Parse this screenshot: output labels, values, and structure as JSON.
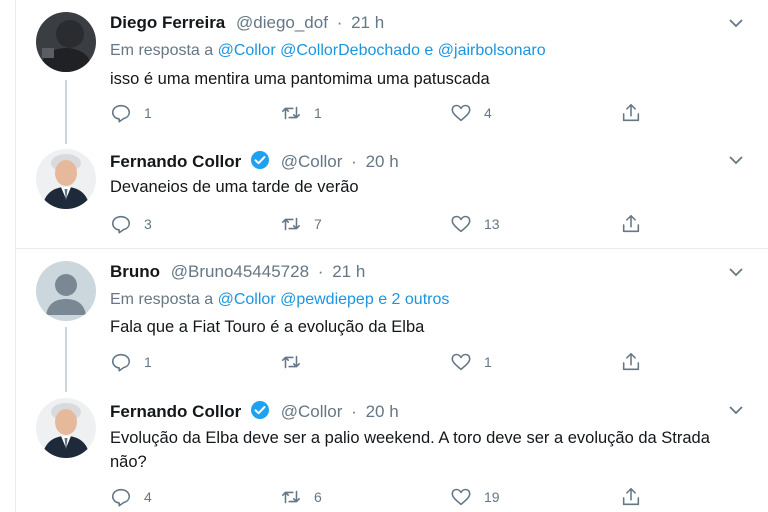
{
  "tweets": [
    {
      "name": "Diego Ferreira",
      "handle": "@diego_dof",
      "dot": "·",
      "time": "21 h",
      "verified": false,
      "reply_prefix": "Em resposta a",
      "reply_mentions": "@Collor @CollorDebochado",
      "reply_and": "e",
      "reply_last": "@jairbolsonaro",
      "text": "isso é uma mentira uma pantomima uma patuscada",
      "replies": "1",
      "retweets": "1",
      "likes": "4"
    },
    {
      "name": "Fernando Collor",
      "handle": "@Collor",
      "dot": "·",
      "time": "20 h",
      "verified": true,
      "text": "Devaneios de uma tarde de verão",
      "replies": "3",
      "retweets": "7",
      "likes": "13"
    },
    {
      "name": "Bruno",
      "handle": "@Bruno45445728",
      "dot": "·",
      "time": "21 h",
      "verified": false,
      "reply_prefix": "Em resposta a",
      "reply_mentions": "@Collor @pewdiepep",
      "reply_and": "e",
      "reply_last": "2 outros",
      "text": "Fala que a Fiat Touro é a evolução da Elba",
      "replies": "1",
      "retweets": "",
      "likes": "1"
    },
    {
      "name": "Fernando Collor",
      "handle": "@Collor",
      "dot": "·",
      "time": "20 h",
      "verified": true,
      "text": "Evolução da Elba deve ser a palio weekend. A toro deve ser a evolução da Strada não?",
      "replies": "4",
      "retweets": "6",
      "likes": "19"
    }
  ],
  "colors": {
    "link": "#1b95e0",
    "muted": "#657786",
    "verified": "#1da1f2",
    "thread_line": "#ccd6dd",
    "divider": "#e6ecf0"
  },
  "icons": {
    "caret": "chevron-down-icon",
    "reply": "reply-icon",
    "retweet": "retweet-icon",
    "like": "heart-icon",
    "share": "share-icon",
    "verified": "verified-badge-icon"
  }
}
